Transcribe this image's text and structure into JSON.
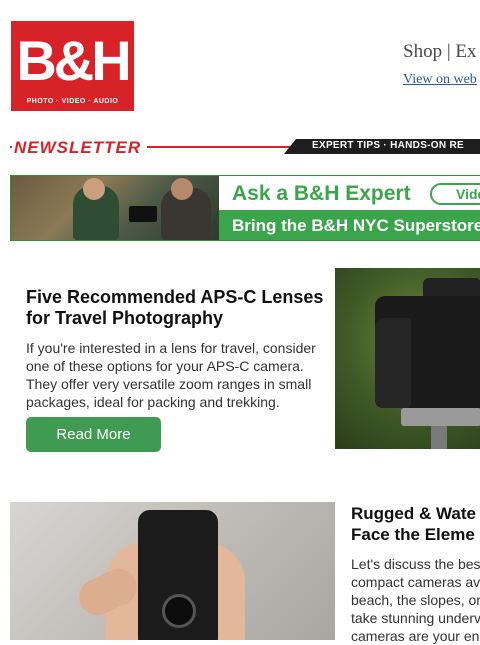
{
  "header": {
    "logo_main": "B&H",
    "logo_sub": "PHOTO · VIDEO · AUDIO",
    "nav_shop": "Shop",
    "nav_sep": " | ",
    "nav_ex": "Ex",
    "view_web": "View on web"
  },
  "newsletter": {
    "title": "NEWSLETTER",
    "tagline": "EXPERT TIPS · HANDS-ON RE"
  },
  "banner": {
    "title": "Ask a B&H Expert",
    "video_label": "Video",
    "subtitle": "Bring the B&H NYC Superstore Ri"
  },
  "article1": {
    "title": "Five Recommended APS-C Lenses for Travel Photography",
    "body": "If you're interested in a lens for travel, consider one of these options for your APS-C camera. They offer very versatile zoom ranges in small packages, ideal for packing and trekking.",
    "button": "Read More"
  },
  "article2": {
    "title_line1": "Rugged & Wate",
    "title_line2": "Face the Eleme",
    "body_lines": [
      "Let's discuss the bes",
      "compact cameras av",
      "beach, the slopes, or",
      "take stunning underv",
      "cameras are your en"
    ]
  },
  "colors": {
    "brand_red": "#d72227",
    "accent_green": "#3aa54a",
    "link_blue": "#2956a8"
  }
}
